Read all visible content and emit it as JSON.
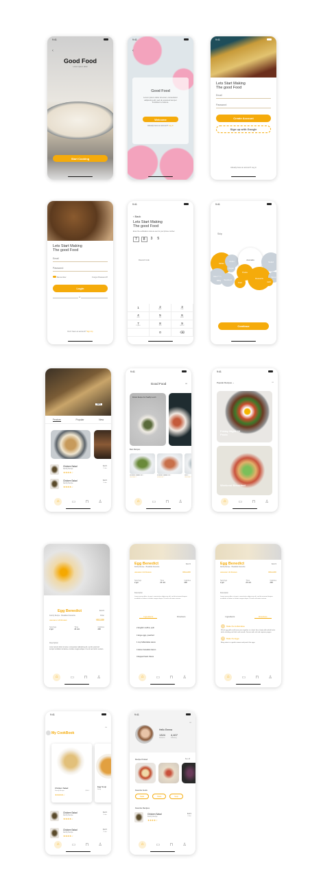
{
  "status": {
    "time": "9:41"
  },
  "nav": {
    "home": "⌂",
    "book": "▭",
    "cart": "⊓",
    "user": "♙"
  },
  "s1": {
    "title": "Good Food",
    "subtitle": "Lorem ipsum dolor",
    "button": "Start Cooking",
    "back": "‹"
  },
  "s2": {
    "back": "‹",
    "title": "Good Food",
    "body": "Lorem ipsum dolor sit amet, consectetur adipiscing elit, sed do eiusmod tempor incididunt ut labore.",
    "button": "Welcome",
    "link_text": "Already have an account?",
    "link": "Log In"
  },
  "s3": {
    "heading1": "Lets Start Making",
    "heading2": "The good Food",
    "email": "Email",
    "password": "Password",
    "button": "Create Account",
    "google": "Sign up with Google",
    "footer": "Already have an account? Log in"
  },
  "s4": {
    "heading1": "Lets Start Making",
    "heading2": "The good Food",
    "email": "Email",
    "password": "Password",
    "remember": "Remember",
    "forgot": "Forgot Password?",
    "button": "Login",
    "or": "or",
    "footer_text": "Don't have an account?",
    "footer_link": "Sign Up"
  },
  "s5": {
    "back": "‹ Back",
    "heading1": "Lets Start Making",
    "heading2": "The good Food",
    "desc": "Enter the verification code we sent to your phone number",
    "code": [
      "7",
      "8",
      "3",
      "5"
    ],
    "resend": "Resend Code",
    "keys": [
      {
        "n": "1",
        "l": ""
      },
      {
        "n": "2",
        "l": "ABC"
      },
      {
        "n": "3",
        "l": "DEF"
      },
      {
        "n": "4",
        "l": "GHI"
      },
      {
        "n": "5",
        "l": "JKL"
      },
      {
        "n": "6",
        "l": "MNO"
      },
      {
        "n": "7",
        "l": "PQRS"
      },
      {
        "n": "8",
        "l": "TUV"
      },
      {
        "n": "9",
        "l": "WXYZ"
      },
      {
        "n": "",
        "l": ""
      },
      {
        "n": "0",
        "l": ""
      },
      {
        "n": "⌫",
        "l": ""
      }
    ]
  },
  "s6": {
    "label": "Skip",
    "bubbles": [
      "Italian",
      "Asian",
      "Avocado",
      "Salad",
      "Vegan",
      "Pasta",
      "Mexican",
      "Seafood",
      "Desserts",
      "Soup",
      "Fish",
      "Grill",
      "BBQ"
    ],
    "button": "Continue"
  },
  "s7": {
    "tag": "NEW",
    "tabs": [
      "Feature",
      "Popular",
      "New"
    ],
    "items": [
      {
        "name": "Chicken Salad",
        "sub": "Family Recipe",
        "price": "$14.5",
        "meta": "Order"
      },
      {
        "name": "Chicken Salad",
        "sub": "Family Recipe",
        "price": "$12.5",
        "meta": "Order"
      }
    ]
  },
  "s8": {
    "title": "Good Food",
    "more": "•••",
    "card_text": "Perfect Recipe For Healthy Lunch",
    "section": "Best Recipes",
    "cards": [
      "Chicken Salad For...",
      "Chicken Salad For...",
      "Chic..."
    ]
  },
  "s9": {
    "title": "Popular Recipes ⌄",
    "more": "•••",
    "cards": [
      "Friday Night Of Pasta",
      "Weekend Breakfast"
    ]
  },
  "s10": {
    "title": "Egg Benedict",
    "sub": "Family Recipe · Breakfast Favourite",
    "price": "$14.5",
    "unit": "Order",
    "rating": "★★★★★ 1.2k Reviews",
    "badge": "Add",
    "stats": [
      {
        "k": "Servings",
        "v": "2 ppl"
      },
      {
        "k": "Time",
        "v": "24 min"
      },
      {
        "k": "Calories",
        "v": "200"
      }
    ],
    "desc_title": "Description",
    "desc": "Lorem ipsum dolor sit amet, consectetur adipiscing elit, sed do eiusmod tempor incididunt ut labore et dolore magna aliqua. Ut enim ad minim veniam."
  },
  "s11": {
    "tabs": [
      "Ingredients",
      "Directions"
    ],
    "ingredients": [
      "2 English muffins, split",
      "4 large eggs, poached",
      "1 cup hollandaise sauce",
      "4 slices Canadian bacon",
      "Chopped fresh chives"
    ]
  },
  "s12": {
    "steps": [
      {
        "n": "1",
        "title": "Make the Hollandaise",
        "text": "Whisk egg yolks and lemon juice together in a bowl, then slowly add melted butter while whisking until thick and smooth. Season with salt and cayenne pepper."
      },
      {
        "n": "2",
        "title": "Make the Eggs",
        "text": "Bring water to a gentle simmer and poach the eggs."
      }
    ]
  },
  "s13": {
    "title": "My CookBook",
    "more": "•••",
    "cards": [
      {
        "name": "Chicken Salad",
        "sub": "Family Recipe",
        "price": "$14.5",
        "meta": "Order"
      },
      {
        "name": "Egg Soup",
        "sub": "Soup"
      }
    ],
    "items": [
      {
        "name": "Chicken Salad",
        "sub": "Family Recipe",
        "price": "$14.5",
        "meta": "Order"
      },
      {
        "name": "Chicken Salad",
        "sub": "Family Recipe",
        "price": "$12.5",
        "meta": "Order"
      }
    ]
  },
  "s14": {
    "more": "•••",
    "name": "Hello Emma",
    "followers": "1324",
    "followers_label": "Followers",
    "following": "4,407",
    "following_label": "Following",
    "posted": "Recipe Posted",
    "see_all": "See all",
    "fav_foods": "Favorite foods",
    "chips": [
      "Salad",
      "Pasta",
      "Soup"
    ],
    "fav_recipes": "Favorite Recipes",
    "recipe": {
      "name": "Chicken Salad",
      "sub": "Family Recipe",
      "price": "$14.5",
      "meta": "Order"
    }
  },
  "stars": "★★★★☆",
  "colors": {
    "accent": "#f5ab0b",
    "grey": "#c9d1d9"
  }
}
